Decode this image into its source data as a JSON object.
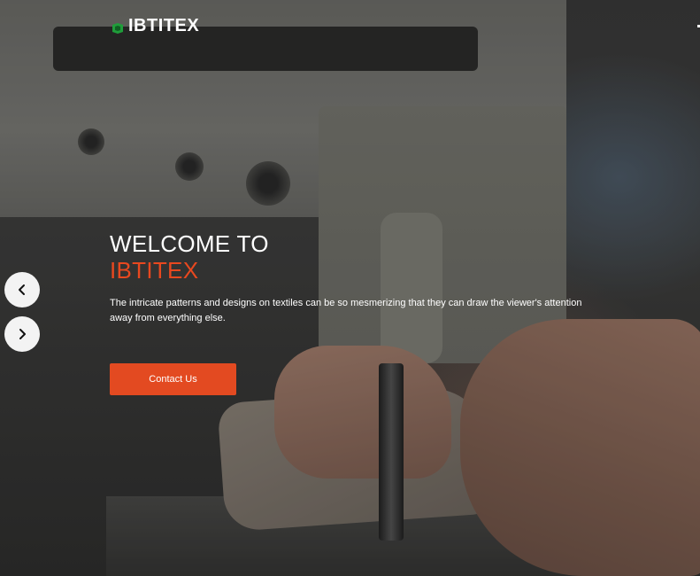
{
  "brand": {
    "name": "IBTITEX",
    "accent_color": "#e34a21",
    "logo_icon": "green-fabric-logo-icon"
  },
  "hero": {
    "title_line1": "WELCOME TO",
    "title_line2": "IBTITEX",
    "subtitle": "The intricate patterns and designs on textiles can be so mesmerizing that they can draw the viewer's attention away from everything else.",
    "cta_label": "Contact Us"
  },
  "slider": {
    "prev_icon": "chevron-left-icon",
    "next_icon": "chevron-right-icon"
  }
}
